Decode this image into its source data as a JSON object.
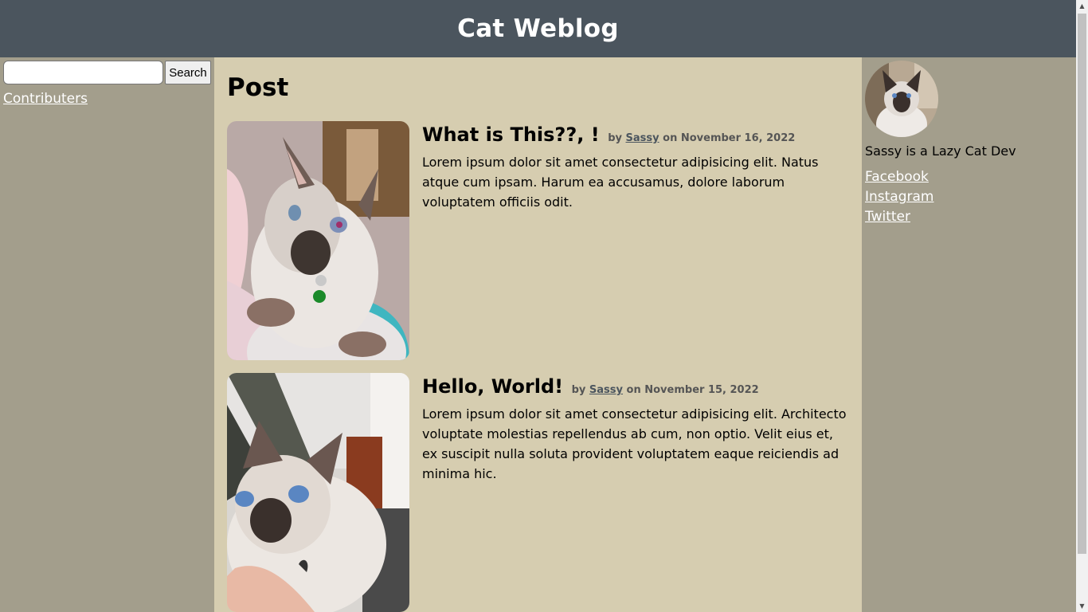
{
  "header": {
    "title": "Cat Weblog"
  },
  "left_sidebar": {
    "search": {
      "placeholder": "",
      "value": "",
      "button_label": "Search"
    },
    "contributers_label": "Contributers"
  },
  "main": {
    "heading": "Post",
    "posts": [
      {
        "title": "What is This??, !",
        "by_label": "by",
        "author": "Sassy",
        "date": "on November 16, 2022",
        "text": "Lorem ipsum dolor sit amet consectetur adipisicing elit. Natus atque cum ipsam. Harum ea accusamus, dolore laborum voluptatem officiis odit."
      },
      {
        "title": "Hello, World!",
        "by_label": "by",
        "author": "Sassy",
        "date": "on November 15, 2022",
        "text": "Lorem ipsum dolor sit amet consectetur adipisicing elit. Architecto voluptate molestias repellendus ab cum, non optio. Velit eius et, ex suscipit nulla soluta provident voluptatem eaque reiciendis ad minima hic."
      }
    ]
  },
  "right_sidebar": {
    "bio": "Sassy is a Lazy Cat Dev",
    "links": [
      "Facebook",
      "Instagram",
      "Twitter"
    ]
  },
  "colors": {
    "header_bg": "#4b555e",
    "main_bg": "#d6cdb0",
    "sidebar_bg": "#a39e8c",
    "author_link": "#4b555e"
  },
  "icons": {
    "scroll_up": "scroll-up-arrow-icon",
    "scroll_down": "scroll-down-arrow-icon"
  }
}
